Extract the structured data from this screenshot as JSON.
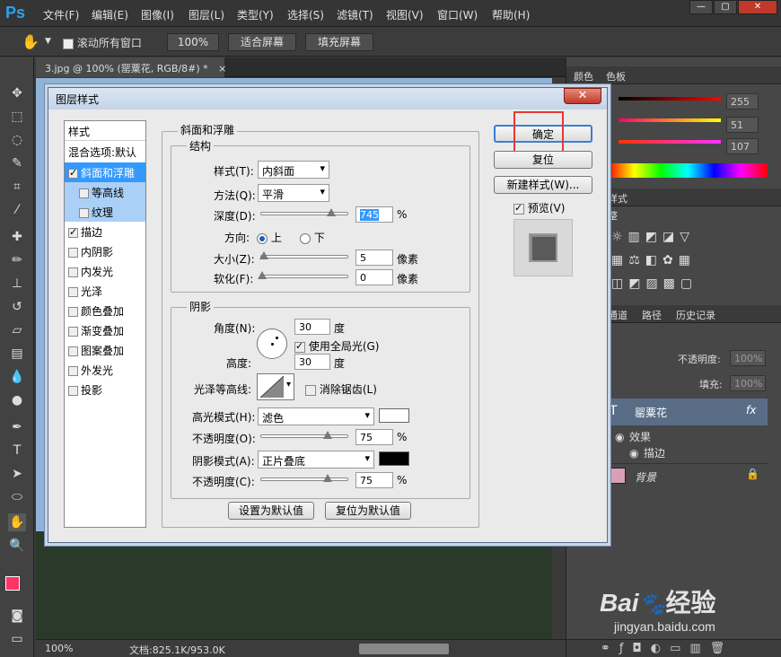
{
  "app": {
    "logo": "Ps"
  },
  "menu": [
    "文件(F)",
    "编辑(E)",
    "图像(I)",
    "图层(L)",
    "类型(Y)",
    "选择(S)",
    "滤镜(T)",
    "视图(V)",
    "窗口(W)",
    "帮助(H)"
  ],
  "window_controls": {
    "minimize": "—",
    "restore": "▢",
    "close": "✕"
  },
  "options": {
    "scroll_all": "滚动所有窗口",
    "zoom": "100%",
    "fit": "适合屏幕",
    "fill": "填充屏幕"
  },
  "document": {
    "tab": "3.jpg @ 100% (罂粟花, RGB/8#) *",
    "tab_close": "×"
  },
  "status": {
    "zoom": "100%",
    "doc": "文档:825.1K/953.0K"
  },
  "dialog": {
    "title": "图层样式",
    "style_header": "样式",
    "blend_options": "混合选项:默认",
    "styles": [
      {
        "label": "斜面和浮雕",
        "checked": true
      },
      {
        "label": "等高线",
        "checked": false
      },
      {
        "label": "纹理",
        "checked": false
      },
      {
        "label": "描边",
        "checked": true
      },
      {
        "label": "内阴影",
        "checked": false
      },
      {
        "label": "内发光",
        "checked": false
      },
      {
        "label": "光泽",
        "checked": false
      },
      {
        "label": "颜色叠加",
        "checked": false
      },
      {
        "label": "渐变叠加",
        "checked": false
      },
      {
        "label": "图案叠加",
        "checked": false
      },
      {
        "label": "外发光",
        "checked": false
      },
      {
        "label": "投影",
        "checked": false
      }
    ],
    "bevel": {
      "title": "斜面和浮雕",
      "structure": "结构",
      "style_label": "样式(T):",
      "style_value": "内斜面",
      "method_label": "方法(Q):",
      "method_value": "平滑",
      "depth_label": "深度(D):",
      "depth_value": "745",
      "depth_unit": "%",
      "depth_fill": 0.8,
      "direction_label": "方向:",
      "dir_up": "上",
      "dir_down": "下",
      "size_label": "大小(Z):",
      "size_value": "5",
      "size_unit": "像素",
      "soften_label": "软化(F):",
      "soften_value": "0",
      "soften_unit": "像素",
      "shading": "阴影",
      "angle_label": "角度(N):",
      "angle_value": "30",
      "angle_unit": "度",
      "global_light": "使用全局光(G)",
      "altitude_label": "高度:",
      "altitude_value": "30",
      "altitude_unit": "度",
      "gloss_label": "光泽等高线:",
      "antialias": "消除锯齿(L)",
      "hl_mode_label": "高光模式(H):",
      "hl_mode_value": "滤色",
      "hl_color": "#ffffff",
      "hl_opacity_label": "不透明度(O):",
      "hl_opacity_value": "75",
      "hl_opacity_unit": "%",
      "hl_opacity_fill": 0.75,
      "sh_mode_label": "阴影模式(A):",
      "sh_mode_value": "正片叠底",
      "sh_color": "#000000",
      "sh_opacity_label": "不透明度(C):",
      "sh_opacity_value": "75",
      "sh_opacity_unit": "%",
      "sh_opacity_fill": 0.75,
      "make_default": "设置为默认值",
      "reset_default": "复位为默认值"
    },
    "ok": "确定",
    "reset": "复位",
    "new_style": "新建样式(W)...",
    "preview": "预览(V)"
  },
  "panels": {
    "color_tab": "颜色",
    "swatch_tab": "色板",
    "rgb_values": [
      "255",
      "51",
      "107"
    ],
    "styles_tab": "样式",
    "adjust_tab": "整",
    "channels_tab": "通道",
    "paths_tab": "路径",
    "history_tab": "历史记录",
    "opacity_label": "不透明度:",
    "opacity_value": "100%",
    "fill_label": "填充:",
    "fill_value": "100%",
    "layers": [
      {
        "name": "罂粟花",
        "fx": "fx"
      },
      {
        "name": "效果"
      },
      {
        "name": "描边"
      },
      {
        "name": "背景"
      }
    ]
  },
  "watermark": {
    "brand": "Bai",
    "brand2": "经验",
    "url": "jingyan.baidu.com"
  },
  "colors": {
    "accent": "#3399ff",
    "highlight_box": "#e53935",
    "fg_color": "#ff3366"
  }
}
